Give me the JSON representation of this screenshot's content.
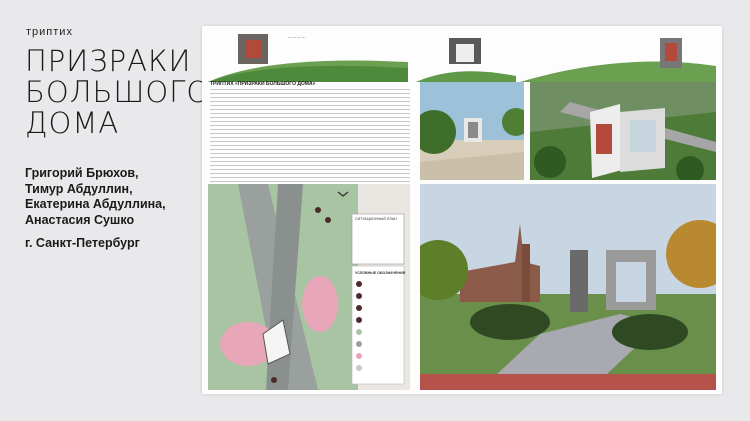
{
  "header": {
    "kicker": "триптих",
    "title_lines": [
      "ПРИЗРАКИ",
      "БОЛЬШОГО",
      "ДОМА"
    ]
  },
  "authors": [
    "Григорий Брюхов,",
    "Тимур Абдуллин,",
    "Екатерина Абдуллина,",
    "Анастасия Сушко"
  ],
  "city": "г. Санкт-Петербург",
  "board": {
    "text_heading": "ТРИПТИХ «ПРИЗРАКИ БОЛЬШОГО ДОМА»",
    "map_legend_title": "УСЛОВНЫЕ ОБОЗНАЧЕНИЯ",
    "plan_caption": "СИТУАЦИОННЫЙ ПЛАН",
    "colors": {
      "lawn": "#8fb48b",
      "path": "#9aa09d",
      "pink": "#e7a7b8",
      "dark": "#3a3a3a"
    }
  }
}
